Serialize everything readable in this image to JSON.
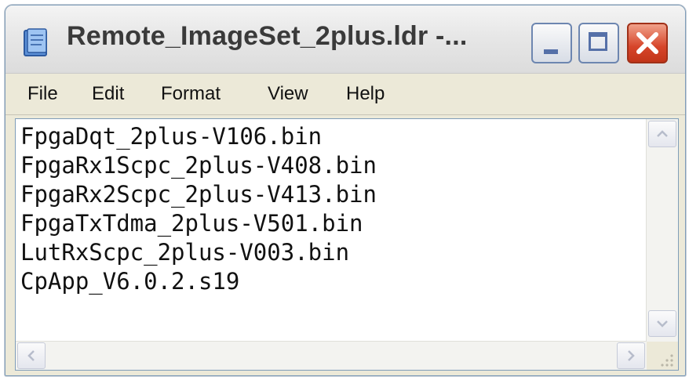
{
  "window": {
    "title": "Remote_ImageSet_2plus.ldr -...",
    "app_icon": "notepad-icon"
  },
  "title_buttons": {
    "minimize_icon": "minimize-icon",
    "maximize_icon": "maximize-icon",
    "close_icon": "close-icon",
    "close_color": "#d6452a"
  },
  "menu": {
    "items": [
      {
        "label": "File"
      },
      {
        "label": "Edit"
      },
      {
        "label": "Format"
      },
      {
        "label": "View"
      },
      {
        "label": "Help"
      }
    ]
  },
  "editor": {
    "lines": [
      "FpgaDqt_2plus-V106.bin",
      "FpgaRx1Scpc_2plus-V408.bin",
      "FpgaRx2Scpc_2plus-V413.bin",
      "FpgaTxTdma_2plus-V501.bin",
      "LutRxScpc_2plus-V003.bin",
      "CpApp_V6.0.2.s19"
    ]
  },
  "scrollbars": {
    "up_icon": "arrow-up-icon",
    "down_icon": "arrow-down-icon",
    "left_icon": "arrow-left-icon",
    "right_icon": "arrow-right-icon",
    "grip_icon": "resize-grip-icon"
  }
}
